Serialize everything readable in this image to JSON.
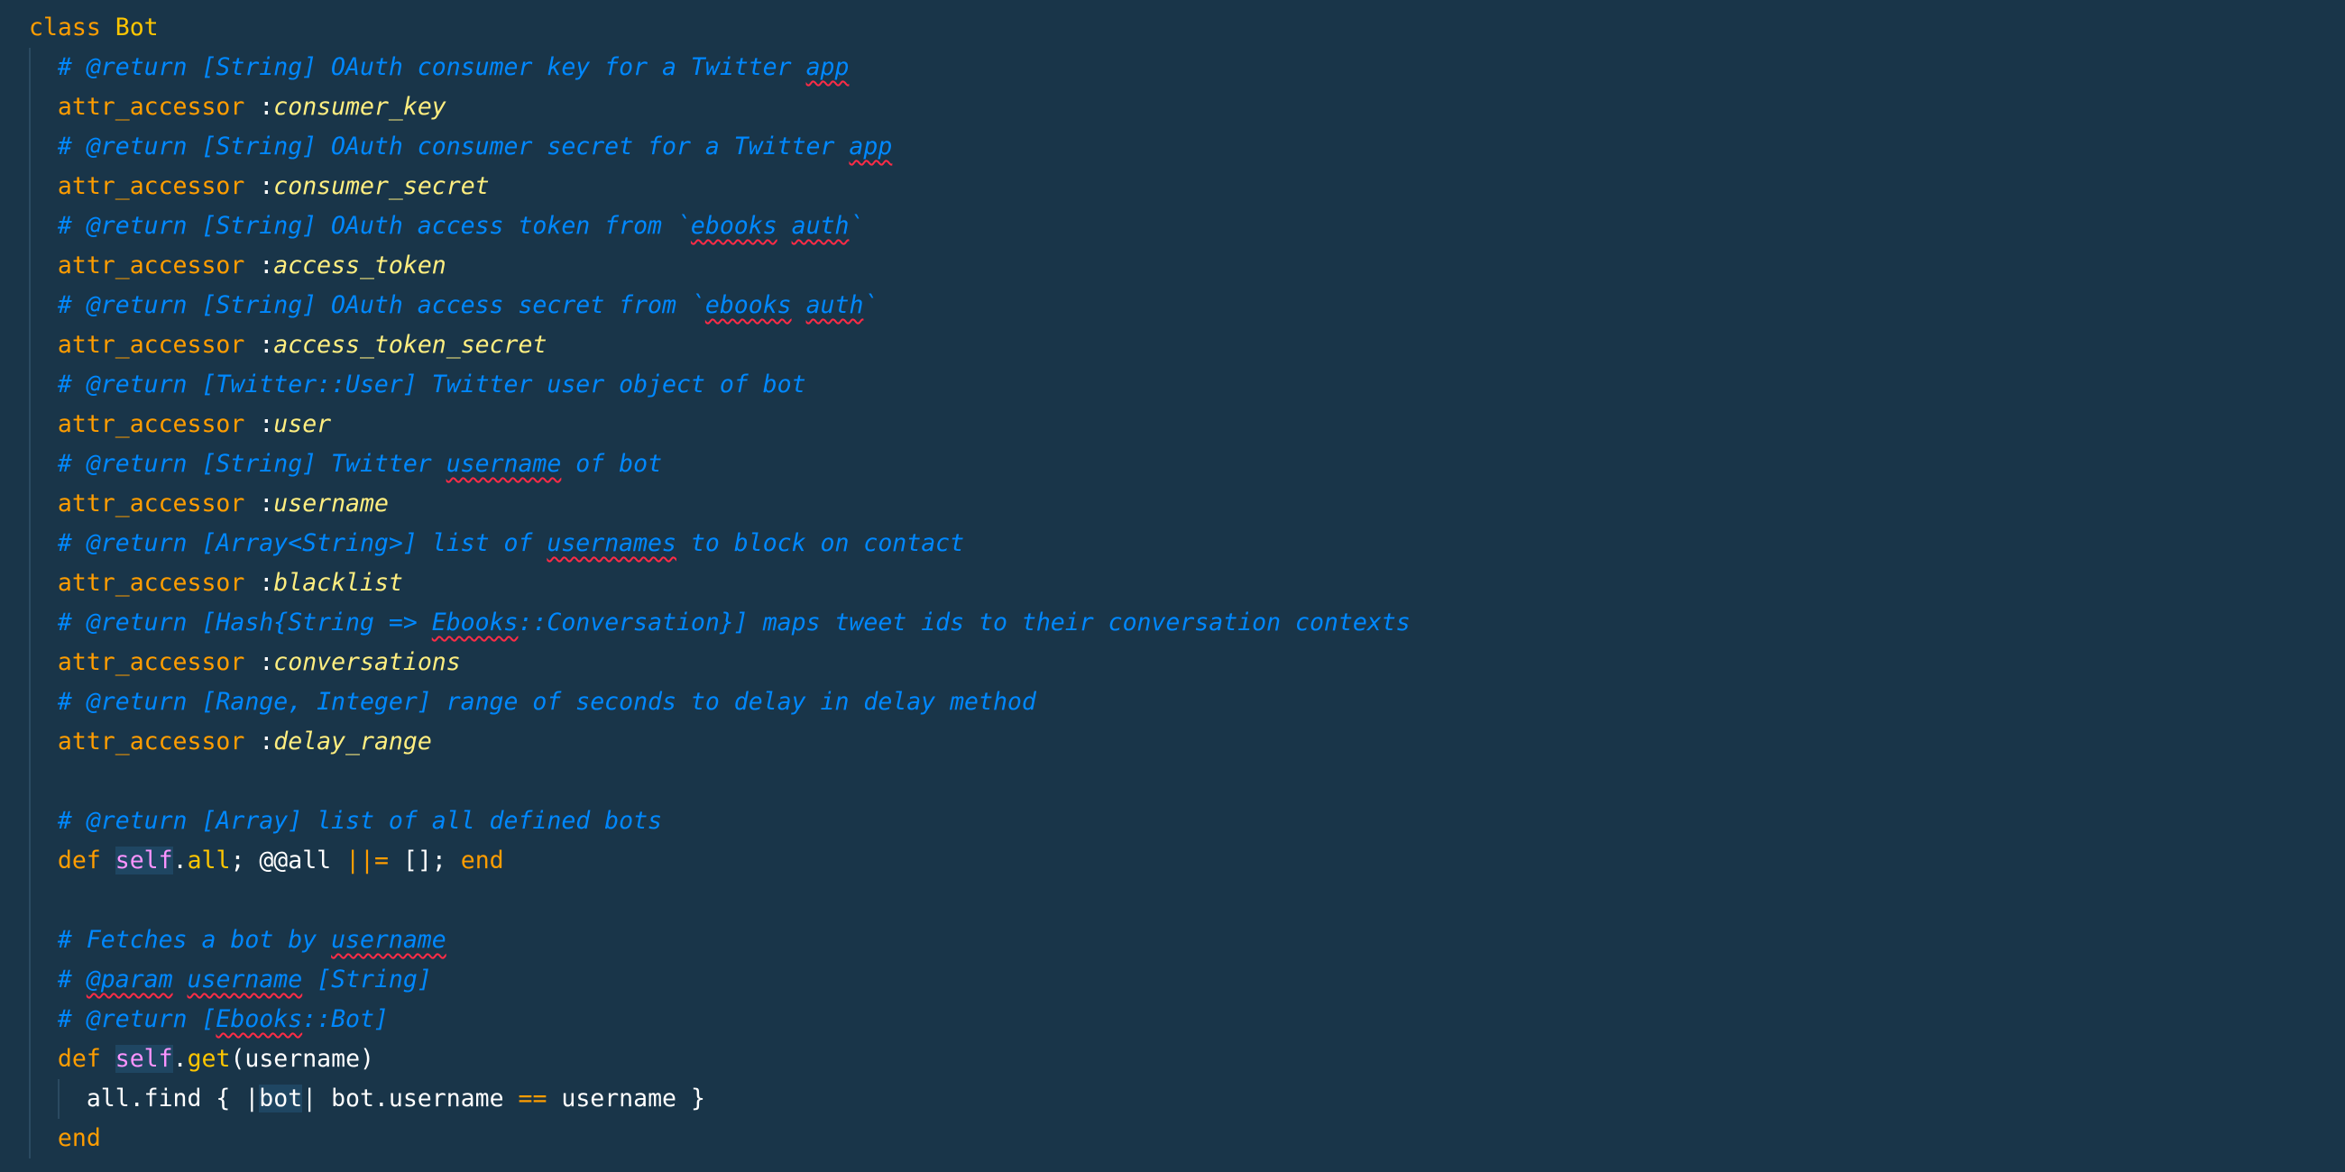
{
  "editor": {
    "class_kw": "class",
    "class_name": "Bot",
    "attr_kw": "attr_accessor",
    "colon": ":",
    "accessors": [
      {
        "pre": "# @return [String] OAuth consumer key for a Twitter ",
        "sq": "app",
        "post": "",
        "sym": "consumer_key"
      },
      {
        "pre": "# @return [String] OAuth consumer secret for a Twitter ",
        "sq": "app",
        "post": "",
        "sym": "consumer_secret"
      },
      {
        "pre": "# @return [String] OAuth access token from `",
        "sq": "ebooks",
        "mid": " ",
        "sq2": "auth",
        "post": "`",
        "sym": "access_token"
      },
      {
        "pre": "# @return [String] OAuth access secret from `",
        "sq": "ebooks",
        "mid": " ",
        "sq2": "auth",
        "post": "`",
        "sym": "access_token_secret"
      },
      {
        "pre": "# @return [Twitter::User] Twitter user object of bot",
        "sym": "user"
      },
      {
        "pre": "# @return [String] Twitter ",
        "sq": "username",
        "post": " of bot",
        "sym": "username"
      },
      {
        "pre": "# @return [Array<String>] list of ",
        "sq": "usernames",
        "post": " to block on contact",
        "sym": "blacklist"
      },
      {
        "pre": "# @return [Hash{String => ",
        "sq": "Ebooks",
        "post": "::Conversation}] maps tweet ids to their conversation contexts",
        "sym": "conversations"
      },
      {
        "pre": "# @return [Range, Integer] range of seconds to delay in delay method",
        "sym": "delay_range"
      }
    ],
    "all_comment": "# @return [Array] list of all defined bots",
    "def_kw": "def",
    "self_kw": "self",
    "dot": ".",
    "all_name": "all",
    "all_rest_1": "; @@all ",
    "or_eq": "||=",
    "all_rest_2": " []; ",
    "end_kw": "end",
    "get_comment_1_pre": "# Fetches a bot by ",
    "get_comment_1_sq": "username",
    "get_comment_2_pre": "# ",
    "get_comment_2_sq": "@param",
    "get_comment_2_mid": " ",
    "get_comment_2_sq2": "username",
    "get_comment_2_post": " [String]",
    "get_comment_3_pre": "# @return [",
    "get_comment_3_sq": "Ebooks",
    "get_comment_3_post": "::Bot]",
    "get_name": "get",
    "get_params": "(username)",
    "body_pre": "all.find { |",
    "body_var": "bot",
    "body_mid": "| bot.username ",
    "body_eq": "==",
    "body_post": " username }"
  }
}
